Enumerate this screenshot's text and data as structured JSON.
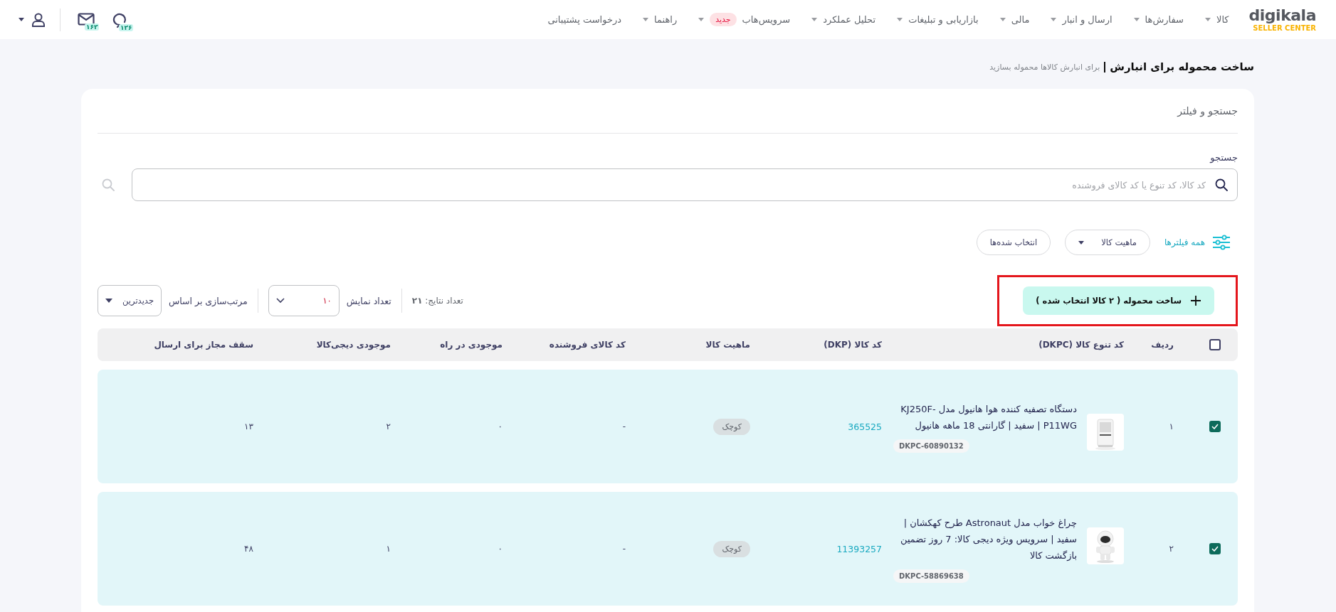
{
  "nav": {
    "logo": {
      "name": "digikala",
      "tagline": "SELLER CENTER"
    },
    "items": [
      {
        "label": "کالا",
        "dropdown": true
      },
      {
        "label": "سفارش‌ها",
        "dropdown": true
      },
      {
        "label": "ارسال و انبار",
        "dropdown": true
      },
      {
        "label": "مالی",
        "dropdown": true
      },
      {
        "label": "بازاریابی و تبلیغات",
        "dropdown": true
      },
      {
        "label": "تحلیل عملکرد",
        "dropdown": true
      },
      {
        "label": "سرویس‌هاب",
        "dropdown": true,
        "badge": "جدید"
      },
      {
        "label": "راهنما",
        "dropdown": true
      },
      {
        "label": "درخواست پشتیبانی",
        "dropdown": false
      }
    ],
    "messages_badge": "۱۶۲",
    "chat_badge": "۱۲۶"
  },
  "page": {
    "title": "ساخت محموله برای انبارش",
    "subtitle": "برای انبارش کالاها محموله بسازید"
  },
  "filter_panel": {
    "title": "جستجو و فیلتر",
    "search": {
      "label": "جستجو",
      "placeholder": "کد کالا، کد تنوع یا کد کالای فروشنده"
    },
    "filters": [
      {
        "label": "همه فیلترها",
        "kind": "all"
      },
      {
        "label": "ماهیت کالا",
        "kind": "dropdown"
      },
      {
        "label": "انتخاب شده‌ها",
        "kind": "toggle"
      }
    ]
  },
  "toolbar": {
    "create_button": {
      "label": "ساخت محموله ( ۲ کالا انتخاب شده )",
      "highlighted": true
    },
    "results": "تعداد نتایج: **۲۱**",
    "page_size": {
      "label": "تعداد نمایش",
      "value": "۱۰"
    },
    "sort": {
      "label": "مرتب‌سازی بر اساس",
      "value": "جدیدترین"
    }
  },
  "table": {
    "all_checked": false,
    "columns": [
      "ردیف",
      "کد تنوع کالا (DKPC)",
      "کد کالا (DKP)",
      "ماهیت کالا",
      "کد کالای فروشنده",
      "موجودی در راه",
      "موجودی دیجی‌کالا",
      "سقف مجاز برای ارسال"
    ],
    "rows": [
      {
        "checked": true,
        "index": "۱",
        "name": "دستگاه تصفیه کننده هوا هانیول مدل KJ250F-P11WG | سفید | گارانتی 18 ماهه هانیول",
        "dkpc": "DKPC-60890132",
        "dkp": "365525",
        "nature": "کوچک",
        "seller_code": "-",
        "in_transit": "۰",
        "stock": "۲",
        "cap": "۱۳"
      },
      {
        "checked": true,
        "index": "۲",
        "name": "چراغ خواب مدل Astronaut طرح کهکشان | سفید | سرویس ویژه دیجی کالا: 7 روز تضمین بازگشت کالا",
        "dkpc": "DKPC-58869638",
        "dkp": "11393257",
        "nature": "کوچک",
        "seller_code": "-",
        "in_transit": "۰",
        "stock": "۱",
        "cap": "۴۸"
      }
    ]
  }
}
